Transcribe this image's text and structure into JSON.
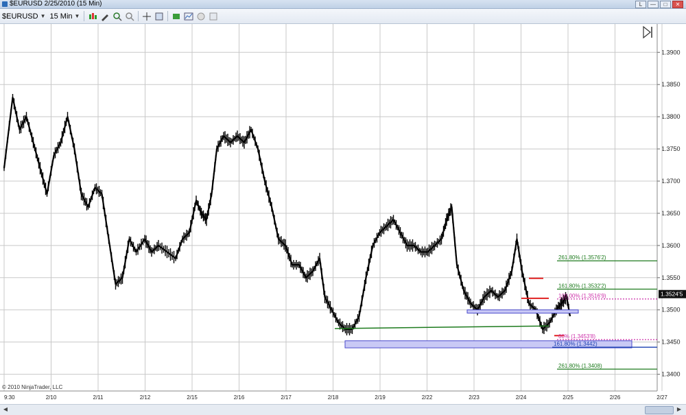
{
  "window": {
    "title": "$EURUSD  2/25/2010 (15 Min)",
    "buttons": [
      "L",
      "—",
      "□",
      "✕"
    ]
  },
  "toolbar": {
    "instrument": "$EURUSD",
    "period": "15 Min"
  },
  "copyright": "© 2010 NinjaTrader, LLC",
  "current_price_label": "1.3524'5",
  "chart_data": {
    "type": "line",
    "title": "",
    "series_name": "",
    "y_ticks": [
      "1.3900",
      "1.3850",
      "1.3800",
      "1.3750",
      "1.3700",
      "1.3650",
      "1.3600",
      "1.3550",
      "1.3500",
      "1.3450",
      "1.3400"
    ],
    "ylim": [
      1.3374,
      1.3944
    ],
    "x_ticks": [
      "9:30",
      "2/10",
      "2/11",
      "2/12",
      "2/15",
      "2/16",
      "2/17",
      "2/18",
      "2/19",
      "2/22",
      "2/23",
      "2/24",
      "2/25",
      "2/26",
      "2/27"
    ],
    "price_path": [
      [
        0,
        1.372
      ],
      [
        0.5,
        1.383
      ],
      [
        0.9,
        1.378
      ],
      [
        1.3,
        1.38
      ],
      [
        1.7,
        1.376
      ],
      [
        2.1,
        1.372
      ],
      [
        2.5,
        1.368
      ],
      [
        2.9,
        1.374
      ],
      [
        3.3,
        1.376
      ],
      [
        3.7,
        1.38
      ],
      [
        4.1,
        1.375
      ],
      [
        4.5,
        1.368
      ],
      [
        4.9,
        1.366
      ],
      [
        5.3,
        1.369
      ],
      [
        5.7,
        1.368
      ],
      [
        6.1,
        1.361
      ],
      [
        6.5,
        1.354
      ],
      [
        6.9,
        1.355
      ],
      [
        7.3,
        1.361
      ],
      [
        7.7,
        1.359
      ],
      [
        8.2,
        1.361
      ],
      [
        8.6,
        1.359
      ],
      [
        9.0,
        1.36
      ],
      [
        9.5,
        1.359
      ],
      [
        10.0,
        1.358
      ],
      [
        10.4,
        1.361
      ],
      [
        10.8,
        1.362
      ],
      [
        11.2,
        1.367
      ],
      [
        11.5,
        1.365
      ],
      [
        11.8,
        1.364
      ],
      [
        12.1,
        1.368
      ],
      [
        12.4,
        1.375
      ],
      [
        12.8,
        1.377
      ],
      [
        13.2,
        1.376
      ],
      [
        13.6,
        1.377
      ],
      [
        14.0,
        1.376
      ],
      [
        14.4,
        1.378
      ],
      [
        14.8,
        1.375
      ],
      [
        15.2,
        1.37
      ],
      [
        15.6,
        1.366
      ],
      [
        16.0,
        1.361
      ],
      [
        16.4,
        1.36
      ],
      [
        16.8,
        1.357
      ],
      [
        17.2,
        1.357
      ],
      [
        17.6,
        1.355
      ],
      [
        18.0,
        1.356
      ],
      [
        18.4,
        1.358
      ],
      [
        18.7,
        1.352
      ],
      [
        19.1,
        1.35
      ],
      [
        19.5,
        1.348
      ],
      [
        19.9,
        1.347
      ],
      [
        20.3,
        1.347
      ],
      [
        20.7,
        1.349
      ],
      [
        21.1,
        1.355
      ],
      [
        21.5,
        1.36
      ],
      [
        21.9,
        1.362
      ],
      [
        22.3,
        1.363
      ],
      [
        22.7,
        1.364
      ],
      [
        23.1,
        1.362
      ],
      [
        23.5,
        1.36
      ],
      [
        23.9,
        1.36
      ],
      [
        24.3,
        1.359
      ],
      [
        24.7,
        1.359
      ],
      [
        25.1,
        1.36
      ],
      [
        25.5,
        1.361
      ],
      [
        25.8,
        1.364
      ],
      [
        26.1,
        1.366
      ],
      [
        26.4,
        1.357
      ],
      [
        26.8,
        1.353
      ],
      [
        27.2,
        1.351
      ],
      [
        27.6,
        1.35
      ],
      [
        28.0,
        1.352
      ],
      [
        28.4,
        1.353
      ],
      [
        28.8,
        1.352
      ],
      [
        29.2,
        1.353
      ],
      [
        29.6,
        1.356
      ],
      [
        29.9,
        1.361
      ],
      [
        30.2,
        1.356
      ],
      [
        30.6,
        1.351
      ],
      [
        31.0,
        1.35
      ],
      [
        31.4,
        1.347
      ],
      [
        31.8,
        1.348
      ],
      [
        32.2,
        1.35
      ],
      [
        32.5,
        1.351
      ],
      [
        32.8,
        1.352
      ],
      [
        33.0,
        1.349
      ]
    ],
    "fibonacci_levels": [
      {
        "label": "261.80% (1.3576'2)",
        "value": 1.35762,
        "color": "#1c7a1c"
      },
      {
        "label": "161.80% (1.3532'2)",
        "value": 1.35322,
        "color": "#1c7a1c"
      },
      {
        "label": "100.00% (1.3516'9)",
        "value": 1.35169,
        "color": "#cc2ea8"
      },
      {
        "label": "00% (1.3453'8)",
        "value": 1.34538,
        "color": "#cc2ea8"
      },
      {
        "label": "161.80% (1.3442)",
        "value": 1.3442,
        "color": "#1a3fb0"
      },
      {
        "label": "261.80% (1.3408)",
        "value": 1.3408,
        "color": "#1c7a1c"
      }
    ],
    "grid": true
  }
}
